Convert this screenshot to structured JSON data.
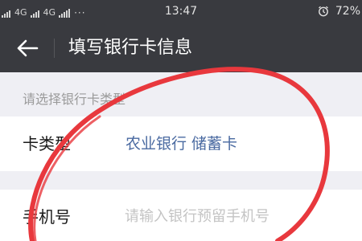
{
  "status_bar": {
    "network_left": "4G",
    "network_main": "4G",
    "dots": "···",
    "time": "13:47",
    "battery": "72%"
  },
  "nav": {
    "title": "填写银行卡信息"
  },
  "form": {
    "section_hint": "请选择银行卡类型",
    "card_type_label": "卡类型",
    "card_type_value": "农业银行 储蓄卡",
    "phone_label": "手机号",
    "phone_placeholder": "请输入银行预留手机号"
  },
  "annotation_color": "#e8383d"
}
